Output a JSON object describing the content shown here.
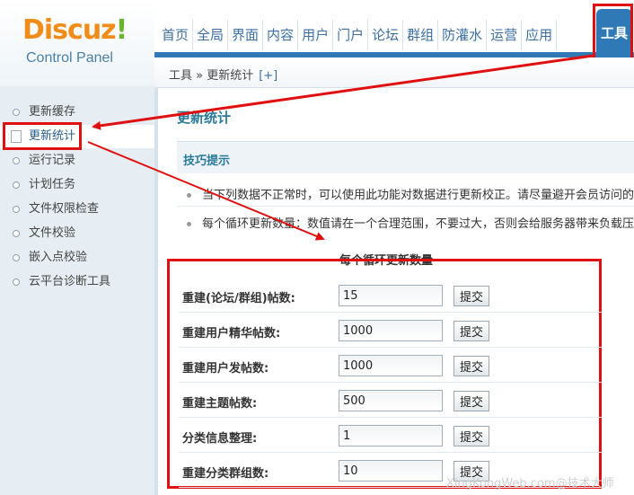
{
  "logo": {
    "brand": "Discuz",
    "bang": "!",
    "subtitle": "Control Panel"
  },
  "nav": {
    "items": [
      "首页",
      "全局",
      "界面",
      "内容",
      "用户",
      "门户",
      "论坛",
      "群组",
      "防灌水",
      "运营",
      "应用"
    ],
    "active": "工具"
  },
  "breadcrumb": {
    "text": "工具 » 更新统计",
    "plus": "[+]"
  },
  "sidebar": {
    "items": [
      "更新缓存",
      "更新统计",
      "运行记录",
      "计划任务",
      "文件权限检查",
      "文件校验",
      "嵌入点校验",
      "云平台诊断工具"
    ],
    "active_index": 1
  },
  "main": {
    "title": "更新统计",
    "tips_title": "技巧提示",
    "tips": [
      "当下列数据不正常时，可以使用此功能对数据进行更新校正。请尽量避开会员访问的",
      "每个循环更新数量：数值请在一个合理范围，不要过大，否则会给服务器带来负载压"
    ],
    "table_caption": "每个循环更新数量",
    "rows": [
      {
        "label": "重建(论坛/群组)帖数:",
        "value": "15",
        "button": "提交"
      },
      {
        "label": "重建用户精华帖数:",
        "value": "1000",
        "button": "提交"
      },
      {
        "label": "重建用户发帖数:",
        "value": "1000",
        "button": "提交"
      },
      {
        "label": "重建主题帖数:",
        "value": "500",
        "button": "提交"
      },
      {
        "label": "分类信息整理:",
        "value": "1",
        "button": "提交"
      },
      {
        "label": "重建分类群组数:",
        "value": "10",
        "button": "提交"
      }
    ]
  },
  "watermark": "XingKongWeb.com@技术大师",
  "colors": {
    "highlight": "#e01010",
    "accent": "#2f7ab6",
    "logo_orange": "#f08c1a",
    "logo_green": "#6ab32c"
  }
}
